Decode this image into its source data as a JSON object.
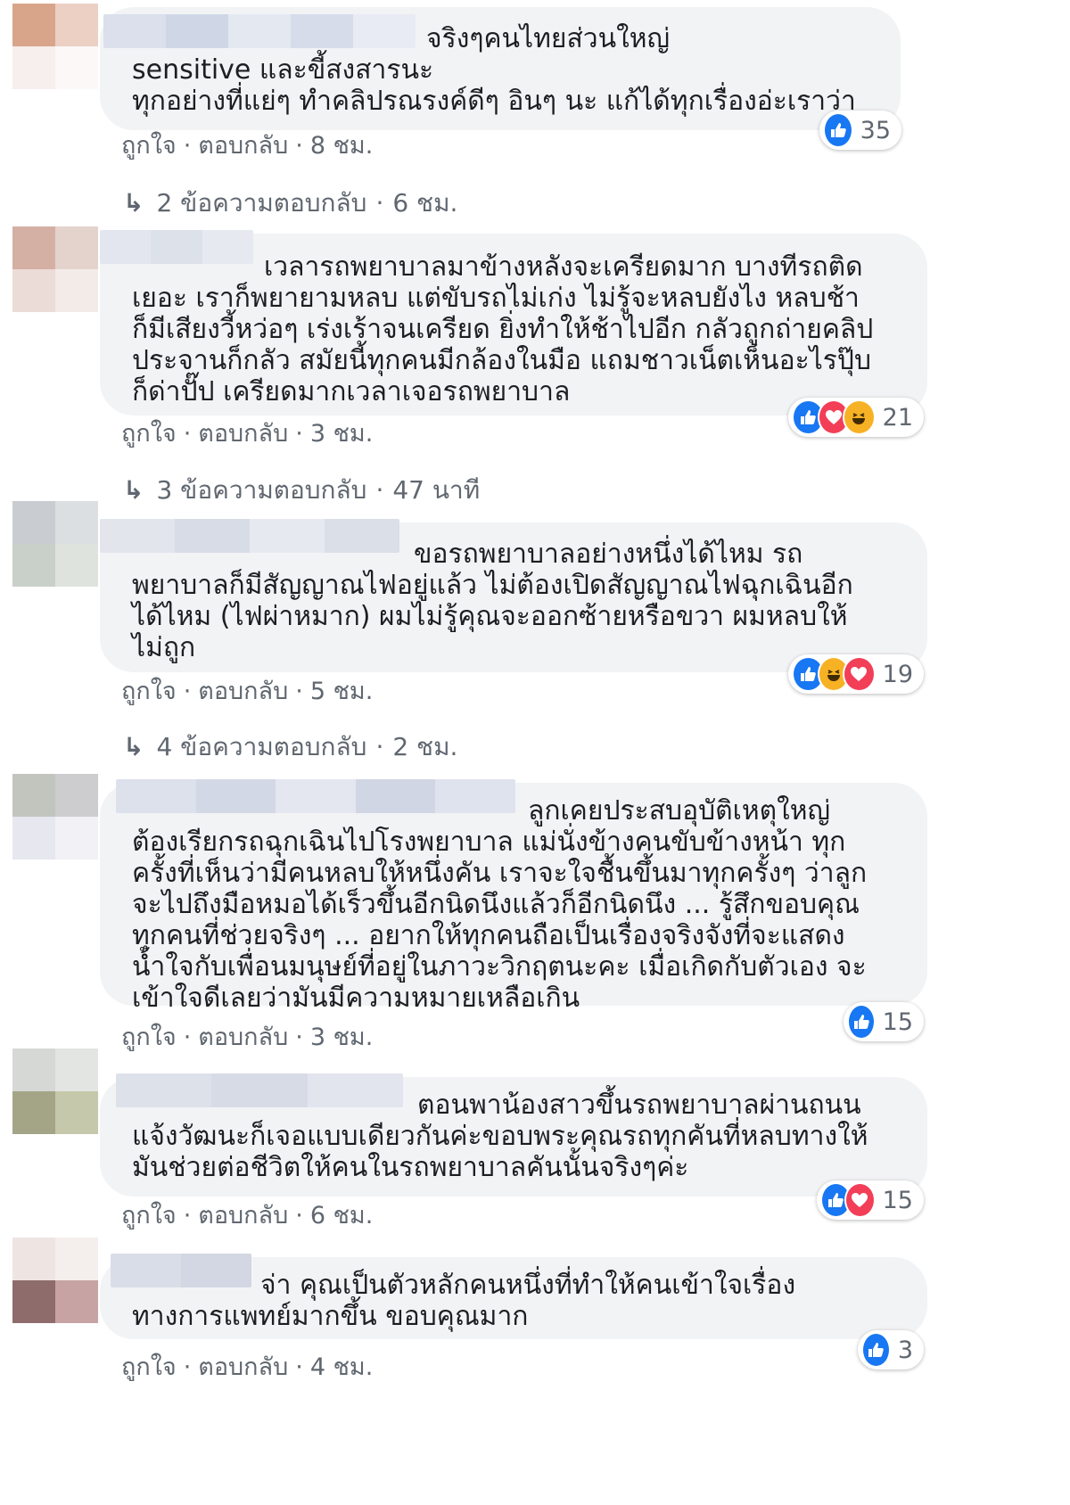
{
  "colors": {
    "bubble": "#f2f3f5",
    "meta_text": "#606770",
    "like": "#1877f2",
    "love": "#f33e58",
    "haha": "#f7b125"
  },
  "actions": {
    "like": "ถูกใจ",
    "separator": "·",
    "reply": "ตอบกลับ"
  },
  "comments": [
    {
      "avatar_colors": [
        "#d9a58a",
        "#ecd0c4",
        "#f6efed",
        "#fbf8f7"
      ],
      "name_colors": [
        "#dbe0ec",
        "#cfd6e6",
        "#e4e8f1",
        "#d6dcea",
        "#e8ebf3"
      ],
      "text": "จริงๆคนไทยส่วนใหญ่\nsensitive และขี้สงสารนะ\nทุกอย่างที่แย่ๆ ทำคลิปรณรงค์ดีๆ อินๆ นะ แก้ได้ทุกเรื่องอ่ะเราว่า",
      "time": "8 ชม.",
      "reactions": [
        "like-icon"
      ],
      "reaction_count": "35",
      "replies": {
        "label": "2 ข้อความตอบกลับ",
        "time": "6 ชม."
      }
    },
    {
      "avatar_colors": [
        "#d4b0a4",
        "#e4d3cd",
        "#ecdcd8",
        "#f3ebe8"
      ],
      "name_colors": [
        "#e3e6ee",
        "#dde1ea",
        "#e6e9f0"
      ],
      "text": "เวลารถพยาบาลมาข้างหลังจะเครียดมาก บางทีรถติด\nเยอะ เราก็พยายามหลบ แต่ขับรถไม่เก่ง ไม่รู้จะหลบยังไง หลบช้า\nก็มีเสียงวี้หว่อๆ เร่งเร้าจนเครียด ยิ่งทำให้ช้าไปอีก กลัวถูกถ่ายคลิป\nประจานก็กลัว สมัยนี้ทุกคนมีกล้องในมือ แถมชาวเน็ตเห็นอะไรปุ๊บ\nก็ด่าปั๊ป เครียดมากเวลาเจอรถพยาบาล",
      "time": "3 ชม.",
      "reactions": [
        "like-icon",
        "love-icon",
        "haha-icon"
      ],
      "reaction_count": "21",
      "replies": {
        "label": "3 ข้อความตอบกลับ",
        "time": "47 นาที"
      }
    },
    {
      "avatar_colors": [
        "#c9ccd0",
        "#dcdfe1",
        "#c9d0c9",
        "#dfe3de"
      ],
      "name_colors": [
        "#e2e5ec",
        "#d7dce6",
        "#e6e9ef",
        "#dadfe8"
      ],
      "text": "ขอรถพยาบาลอย่างหนึ่งได้ไหม รถ\nพยาบาลก็มีสัญญาณไฟอยู่แล้ว ไม่ต้องเปิดสัญญาณไฟฉุกเฉินอีก\nได้ไหม (ไฟผ่าหมาก) ผมไม่รู้คุณจะออกซ้ายหรือขวา ผมหลบให้\nไม่ถูก",
      "time": "5 ชม.",
      "reactions": [
        "like-icon",
        "haha-icon",
        "love-icon"
      ],
      "reaction_count": "19",
      "replies": {
        "label": "4 ข้อความตอบกลับ",
        "time": "2 ชม."
      }
    },
    {
      "avatar_colors": [
        "#c2c5be",
        "#cdcccf",
        "#e6e7ef",
        "#f1f1f6"
      ],
      "name_colors": [
        "#dde1ec",
        "#d3d8e6",
        "#e4e7f0",
        "#d0d6e4",
        "#dfe3ed"
      ],
      "text": "ลูกเคยประสบอุบัติเหตุใหญ่\nต้องเรียกรถฉุกเฉินไปโรงพยาบาล แม่นั่งข้างคนขับข้างหน้า ทุก\nครั้งที่เห็นว่ามีคนหลบให้หนึ่งคัน เราจะใจชื้นขึ้นมาทุกครั้งๆ ว่าลูก\nจะไปถึงมือหมอได้เร็วขึ้นอีกนิดนึงแล้วก็อีกนิดนึง ... รู้สึกขอบคุณ\nทุกคนที่ช่วยจริงๆ ... อยากให้ทุกคนถือเป็นเรื่องจริงจังที่จะแสดง\nน้ำใจกับเพื่อนมนุษย์ที่อยู่ในภาวะวิกฤตนะคะ เมื่อเกิดกับตัวเอง จะ\nเข้าใจดีเลยว่ามันมีความหมายเหลือเกิน",
      "time": "3 ชม.",
      "reactions": [
        "like-icon"
      ],
      "reaction_count": "15",
      "replies": null
    },
    {
      "avatar_colors": [
        "#d6d8d5",
        "#e3e5e2",
        "#a4a586",
        "#c5c8aa"
      ],
      "name_colors": [
        "#dde1ea",
        "#d6dbe6",
        "#e2e5ee"
      ],
      "text": "ตอนพาน้องสาวขึ้นรถพยาบาลผ่านถนน\nแจ้งวัฒนะก็เจอแบบเดียวกันค่ะขอบพระคุณรถทุกคันที่หลบทางให้\nมันช่วยต่อชีวิตให้คนในรถพยาบาลคันนั้นจริงๆค่ะ",
      "time": "6 ชม.",
      "reactions": [
        "like-icon",
        "love-icon"
      ],
      "reaction_count": "15",
      "replies": null
    },
    {
      "avatar_colors": [
        "#eee5e3",
        "#f4eeec",
        "#8f6c6c",
        "#c7a3a3"
      ],
      "name_colors": [
        "#d9dde8",
        "#d2d7e3"
      ],
      "text": "จ่า คุณเป็นตัวหลักคนหนึ่งที่ทำให้คนเข้าใจเรื่อง\nทางการแพทย์มากขึ้น ขอบคุณมาก",
      "time": "4 ชม.",
      "reactions": [
        "like-icon"
      ],
      "reaction_count": "3",
      "replies": null
    }
  ]
}
